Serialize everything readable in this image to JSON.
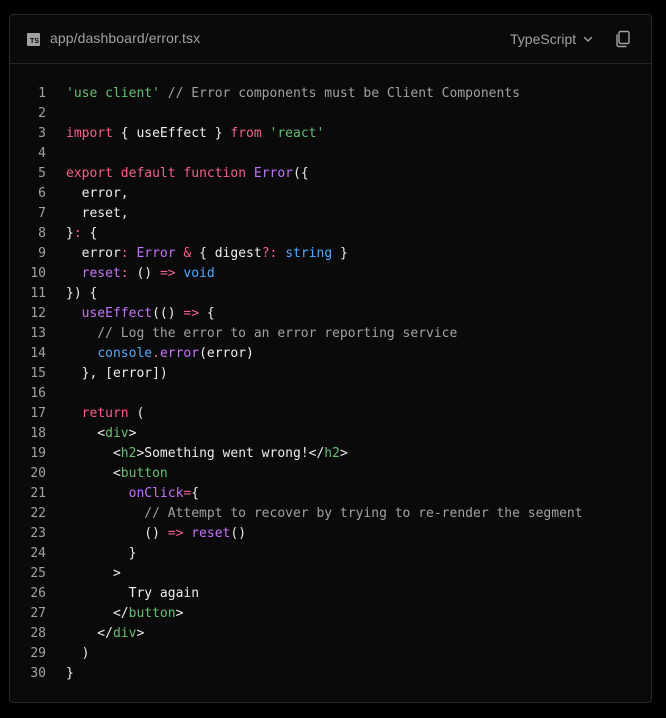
{
  "header": {
    "file_badge": "TS",
    "filename": "app/dashboard/error.tsx",
    "language": "TypeScript",
    "icons": {
      "file": "typescript-file-icon",
      "dropdown": "chevron-down-icon",
      "copy": "copy-icon"
    }
  },
  "colors": {
    "background": "#0a0a0a",
    "text": "#ededed",
    "muted": "#a1a1a1",
    "string": "#62c073",
    "keyword": "#f75f8f",
    "function": "#c472fb",
    "type": "#52a8ff"
  },
  "code": {
    "lines": [
      [
        [
          "s",
          "'use client'"
        ],
        [
          "p",
          " "
        ],
        [
          "c",
          "// Error components must be Client Components"
        ]
      ],
      [],
      [
        [
          "k",
          "import"
        ],
        [
          "p",
          " { useEffect } "
        ],
        [
          "k",
          "from"
        ],
        [
          "p",
          " "
        ],
        [
          "s",
          "'react'"
        ]
      ],
      [],
      [
        [
          "k",
          "export"
        ],
        [
          "p",
          " "
        ],
        [
          "k",
          "default"
        ],
        [
          "p",
          " "
        ],
        [
          "k",
          "function"
        ],
        [
          "p",
          " "
        ],
        [
          "f",
          "Error"
        ],
        [
          "p",
          "({"
        ]
      ],
      [
        [
          "p",
          "  error,"
        ]
      ],
      [
        [
          "p",
          "  reset,"
        ]
      ],
      [
        [
          "p",
          "}"
        ],
        [
          "k",
          ":"
        ],
        [
          "p",
          " {"
        ]
      ],
      [
        [
          "p",
          "  error"
        ],
        [
          "k",
          ":"
        ],
        [
          "p",
          " "
        ],
        [
          "f",
          "Error"
        ],
        [
          "p",
          " "
        ],
        [
          "k",
          "&"
        ],
        [
          "p",
          " { digest"
        ],
        [
          "k",
          "?:"
        ],
        [
          "p",
          " "
        ],
        [
          "t",
          "string"
        ],
        [
          "p",
          " }"
        ]
      ],
      [
        [
          "p",
          "  "
        ],
        [
          "f",
          "reset"
        ],
        [
          "k",
          ":"
        ],
        [
          "p",
          " () "
        ],
        [
          "k",
          "=>"
        ],
        [
          "p",
          " "
        ],
        [
          "t",
          "void"
        ]
      ],
      [
        [
          "p",
          "}) {"
        ]
      ],
      [
        [
          "p",
          "  "
        ],
        [
          "f",
          "useEffect"
        ],
        [
          "p",
          "(() "
        ],
        [
          "k",
          "=>"
        ],
        [
          "p",
          " {"
        ]
      ],
      [
        [
          "c",
          "    // Log the error to an error reporting service"
        ]
      ],
      [
        [
          "p",
          "    "
        ],
        [
          "t",
          "console"
        ],
        [
          "k",
          "."
        ],
        [
          "f",
          "error"
        ],
        [
          "p",
          "(error)"
        ]
      ],
      [
        [
          "p",
          "  }, [error])"
        ]
      ],
      [],
      [
        [
          "p",
          "  "
        ],
        [
          "k",
          "return"
        ],
        [
          "p",
          " ("
        ]
      ],
      [
        [
          "p",
          "    <"
        ],
        [
          "tg",
          "div"
        ],
        [
          "p",
          ">"
        ]
      ],
      [
        [
          "p",
          "      <"
        ],
        [
          "tg",
          "h2"
        ],
        [
          "p",
          ">Something went wrong!</"
        ],
        [
          "tg",
          "h2"
        ],
        [
          "p",
          ">"
        ]
      ],
      [
        [
          "p",
          "      <"
        ],
        [
          "tg",
          "button"
        ]
      ],
      [
        [
          "p",
          "        "
        ],
        [
          "f",
          "onClick"
        ],
        [
          "k",
          "="
        ],
        [
          "p",
          "{"
        ]
      ],
      [
        [
          "c",
          "          // Attempt to recover by trying to re-render the segment"
        ]
      ],
      [
        [
          "p",
          "          () "
        ],
        [
          "k",
          "=>"
        ],
        [
          "p",
          " "
        ],
        [
          "f",
          "reset"
        ],
        [
          "p",
          "()"
        ]
      ],
      [
        [
          "p",
          "        }"
        ]
      ],
      [
        [
          "p",
          "      >"
        ]
      ],
      [
        [
          "p",
          "        Try again"
        ]
      ],
      [
        [
          "p",
          "      </"
        ],
        [
          "tg",
          "button"
        ],
        [
          "p",
          ">"
        ]
      ],
      [
        [
          "p",
          "    </"
        ],
        [
          "tg",
          "div"
        ],
        [
          "p",
          ">"
        ]
      ],
      [
        [
          "p",
          "  )"
        ]
      ],
      [
        [
          "p",
          "}"
        ]
      ]
    ]
  }
}
